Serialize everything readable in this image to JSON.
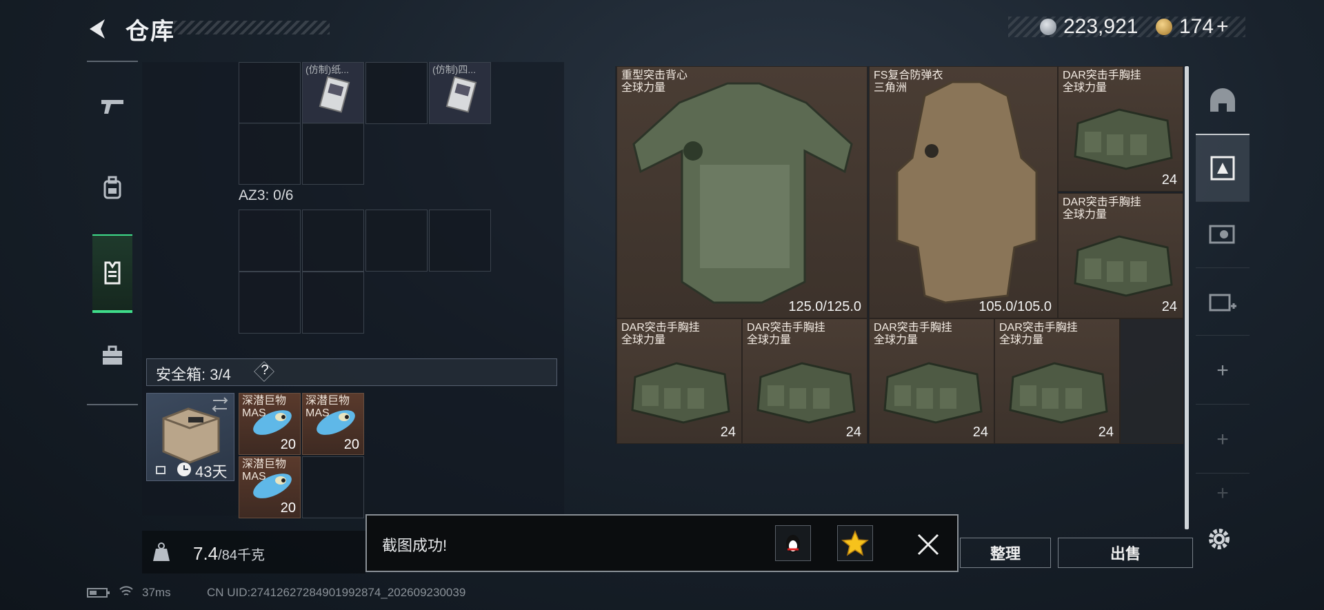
{
  "header": {
    "title": "仓库",
    "silver_amount": "223,921",
    "gold_amount": "174",
    "gold_add": "+"
  },
  "sidebar": {
    "items": [
      {
        "icon": "pistol-icon"
      },
      {
        "icon": "backpack-icon"
      },
      {
        "icon": "vest-icon",
        "active": true
      },
      {
        "icon": "briefcase-icon"
      }
    ]
  },
  "left_panel": {
    "top_items": [
      "(仿制)纸...",
      "(仿制)四..."
    ],
    "az3_label": "AZ3: 0/6",
    "safebox_label": "安全箱: 3/4",
    "help_label": "?",
    "safe_timer": "43天",
    "lures": [
      {
        "name": "深潜巨物",
        "sub": "MAS",
        "qty": "20"
      },
      {
        "name": "深潜巨物",
        "sub": "MAS",
        "qty": "20"
      },
      {
        "name": "深潜巨物",
        "sub": "MAS",
        "qty": "20"
      }
    ],
    "weight_current": "7.4",
    "weight_total": "/84千克"
  },
  "right_panel": {
    "items": [
      {
        "name": "重型突击背心",
        "sub": "全球力量",
        "value": "125.0/125.0"
      },
      {
        "name": "FS复合防弹衣",
        "sub": "三角洲",
        "value": "105.0/105.0"
      },
      {
        "name": "DAR突击手胸挂",
        "sub": "全球力量",
        "value": "24"
      },
      {
        "name": "DAR突击手胸挂",
        "sub": "全球力量",
        "value": "24"
      },
      {
        "name": "DAR突击手胸挂",
        "sub": "全球力量",
        "value": "24"
      },
      {
        "name": "DAR突击手胸挂",
        "sub": "全球力量",
        "value": "24"
      },
      {
        "name": "DAR突击手胸挂",
        "sub": "全球力量",
        "value": "24"
      },
      {
        "name": "DAR突击手胸挂",
        "sub": "全球力量",
        "value": "24"
      }
    ]
  },
  "right_column": {
    "items": [
      "helmet-icon",
      "vest-slot-icon",
      "ammo-icon",
      "add-slot-icon",
      "plus-icon",
      "plus-icon",
      "plus-icon"
    ]
  },
  "toast": {
    "message": "截图成功!"
  },
  "buttons": {
    "sort": "整理",
    "sell": "出售"
  },
  "status_bar": {
    "ping": "37ms",
    "uid": "CN UID:27412627284901992874_202609230039"
  },
  "colors": {
    "accent_green": "#3fdc8a",
    "item_brown": "#4a3d34",
    "background": "#19222c"
  }
}
